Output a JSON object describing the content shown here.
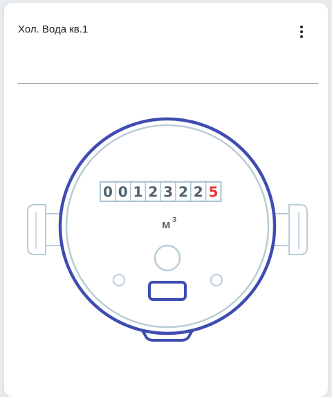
{
  "card": {
    "title": "Хол. Вода кв.1"
  },
  "meter": {
    "digits": [
      "0",
      "0",
      "1",
      "2",
      "3",
      "2",
      "2",
      "5"
    ],
    "highlighted_digit_index": 7,
    "unit": "м",
    "unit_superscript": "3",
    "colors": {
      "ring": "#3f4cb0",
      "inner": "#b9ccd6",
      "digit_box": "#a9c3cf",
      "digit_normal": "#4e6270",
      "digit_highlight": "#e53935"
    }
  },
  "icons": {
    "menu": "more-vert-icon"
  }
}
